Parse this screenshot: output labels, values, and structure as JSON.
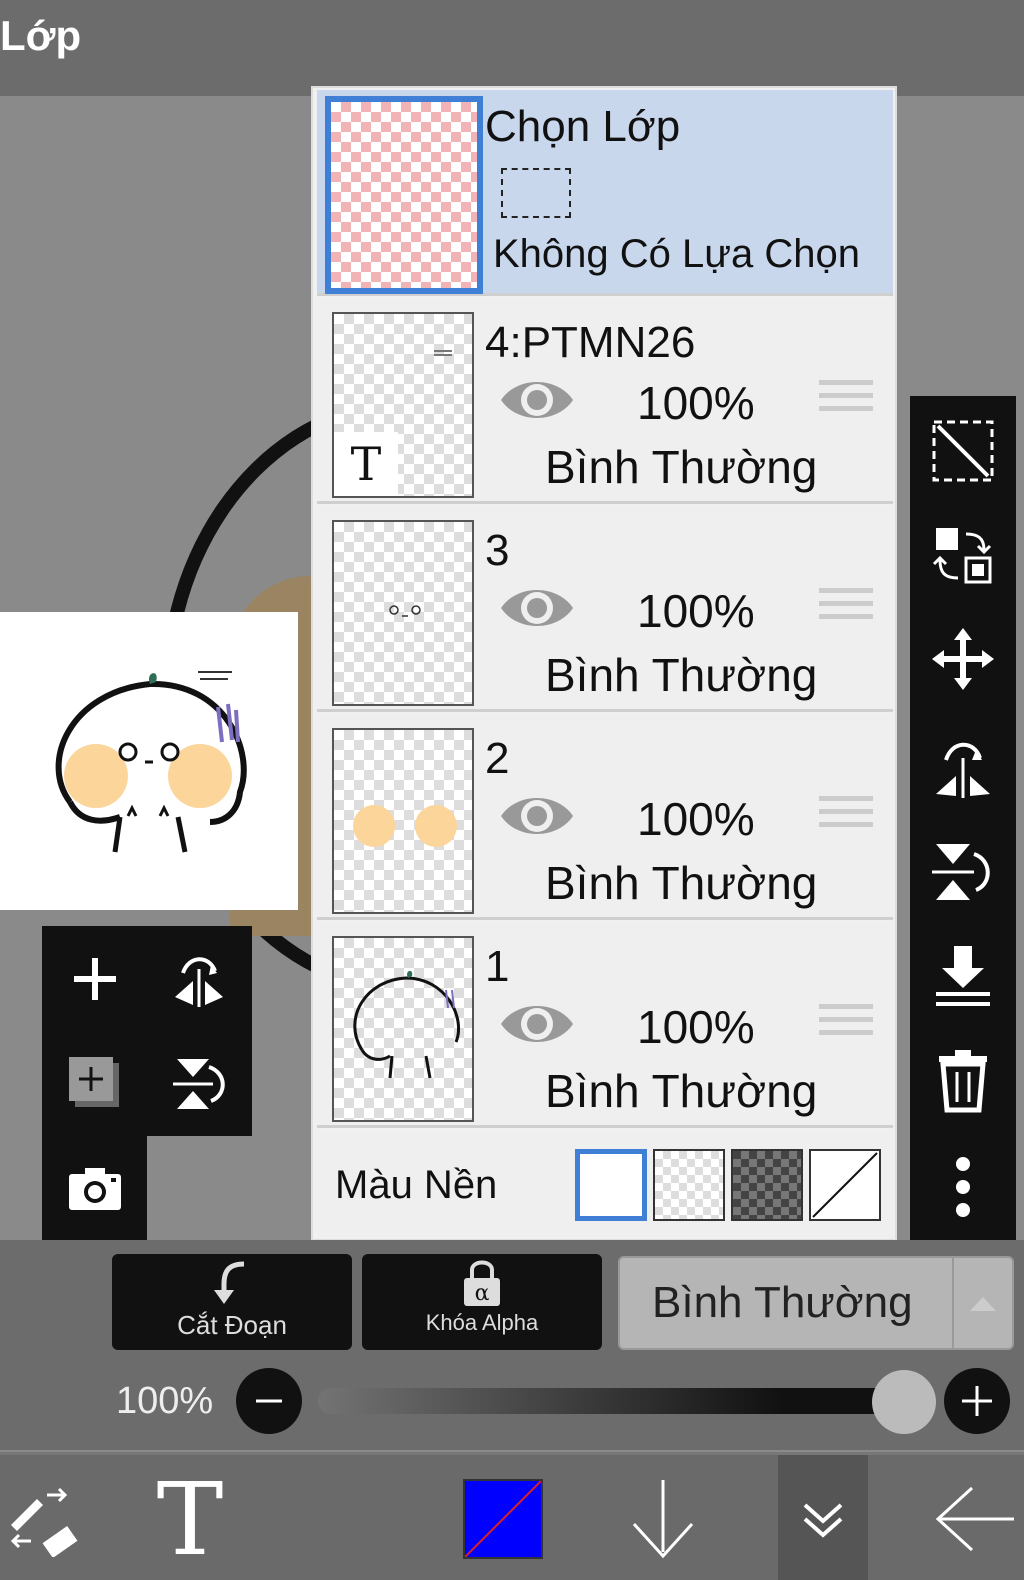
{
  "header": {
    "title": "Lớp"
  },
  "layers": [
    {
      "name": "4:PTMN26",
      "opacity": "100%",
      "blend": "Bình Thường"
    },
    {
      "name": "3",
      "opacity": "100%",
      "blend": "Bình Thường"
    },
    {
      "name": "2",
      "opacity": "100%",
      "blend": "Bình Thường"
    },
    {
      "name": "1",
      "opacity": "100%",
      "blend": "Bình Thường"
    }
  ],
  "selection_layer": {
    "title": "Chọn Lớp",
    "status": "Không Có Lựa Chọn"
  },
  "background": {
    "label": "Màu Nền"
  },
  "thumbnail_text": {
    "t_label": "T"
  },
  "bottom": {
    "clip_label": "Cắt Đoạn",
    "alpha_lock_label": "Khóa Alpha",
    "blend_mode": "Bình Thường",
    "opacity_label": "100%",
    "opacity_value": 1.0
  },
  "toolbar": {
    "text_tool": "T"
  },
  "colors": {
    "accent": "#3f7fd6",
    "primary_color": "#0000ff",
    "panel_bg": "#efefef"
  }
}
